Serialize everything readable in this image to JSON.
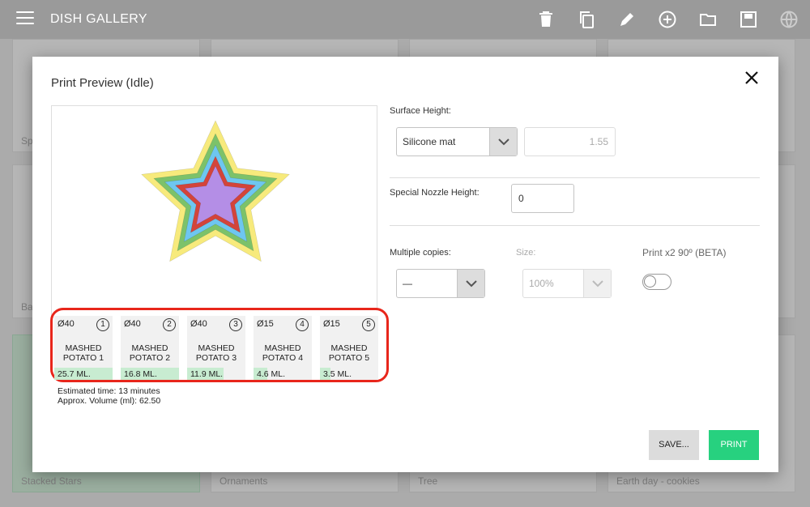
{
  "app": {
    "title": "DISH GALLERY"
  },
  "toolbar_icons": [
    "trash-icon",
    "copy-icon",
    "pencil-icon",
    "add-circle-icon",
    "folder-icon",
    "save-icon",
    "globe-icon"
  ],
  "gallery": {
    "visible_labels": [
      "Spe",
      "Bal",
      "Stacked Stars",
      "Ornaments",
      "Tree",
      "Earth day - cookies"
    ]
  },
  "dialog": {
    "title": "Print Preview (Idle)",
    "close_icon": "close-icon",
    "trays": [
      {
        "diameter": "Ø40",
        "number": "1",
        "name_line1": "MASHED",
        "name_line2": "POTATO 1",
        "volume": "25.7 ML.",
        "fill": 1.0
      },
      {
        "diameter": "Ø40",
        "number": "2",
        "name_line1": "MASHED",
        "name_line2": "POTATO 2",
        "volume": "16.8 ML.",
        "fill": 1.0
      },
      {
        "diameter": "Ø40",
        "number": "3",
        "name_line1": "MASHED",
        "name_line2": "POTATO 3",
        "volume": "11.9 ML.",
        "fill": 0.62
      },
      {
        "diameter": "Ø15",
        "number": "4",
        "name_line1": "MASHED",
        "name_line2": "POTATO 4",
        "volume": "4.6 ML.",
        "fill": 0.24
      },
      {
        "diameter": "Ø15",
        "number": "5",
        "name_line1": "MASHED",
        "name_line2": "POTATO 5",
        "volume": "3.5 ML.",
        "fill": 0.18
      }
    ],
    "estimated_time": "Estimated time: 13 minutes",
    "approx_volume": "Approx. Volume (ml): 62.50",
    "surface_height": {
      "label": "Surface Height:",
      "selected": "Silicone mat",
      "value": "1.55"
    },
    "special_nozzle": {
      "label": "Special Nozzle Height:",
      "value": "0"
    },
    "multiple_copies": {
      "label": "Multiple copies:",
      "selected": "—"
    },
    "size": {
      "label": "Size:",
      "selected": "100%"
    },
    "print_x2": {
      "label": "Print x2 90º (BETA)",
      "on": false
    },
    "buttons": {
      "save": "SAVE...",
      "print": "PRINT"
    }
  },
  "star_colors": [
    "#f7ea7c",
    "#7cc26a",
    "#6ec6f0",
    "#d3443a",
    "#b48ee6"
  ]
}
